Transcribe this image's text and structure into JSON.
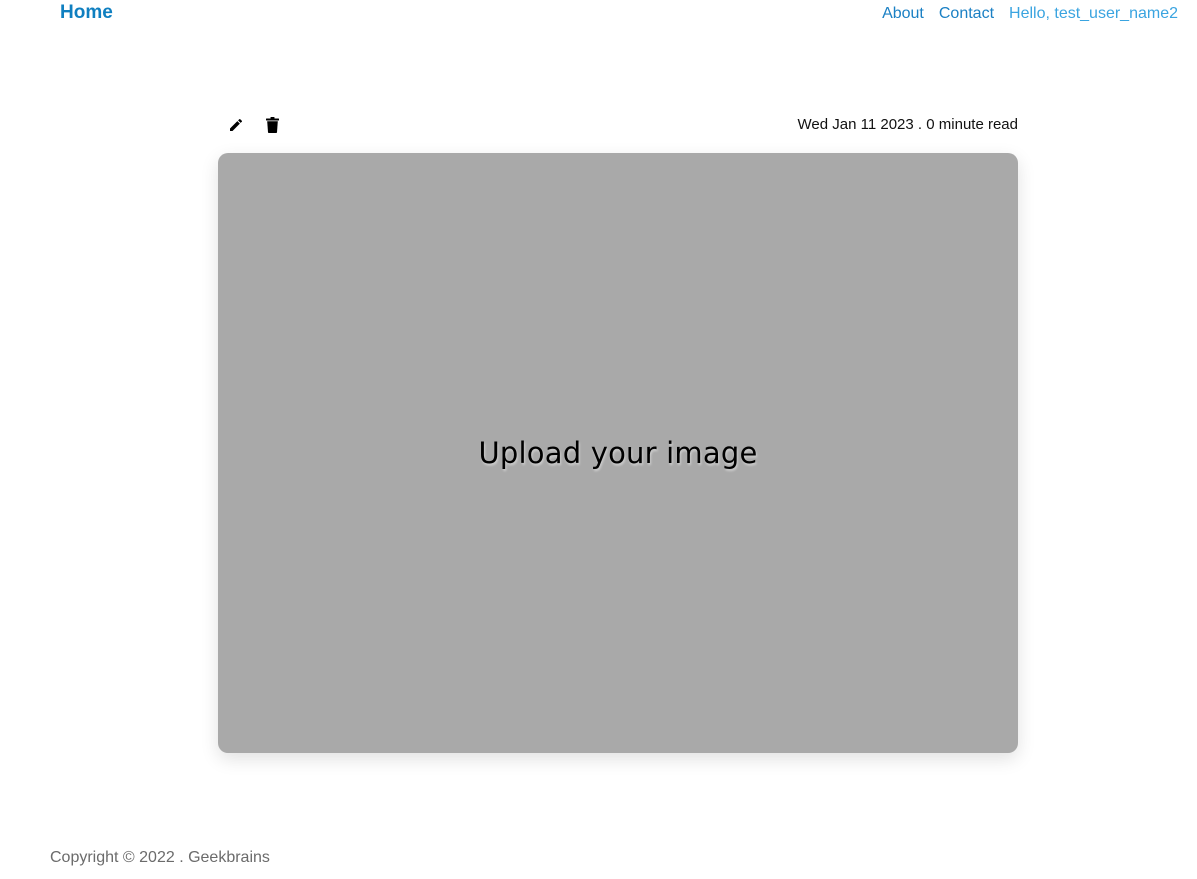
{
  "header": {
    "home_label": "Home",
    "nav": {
      "about": "About",
      "contact": "Contact",
      "greeting": "Hello, test_user_name2"
    }
  },
  "post": {
    "actions": {
      "edit_icon": "pencil-icon",
      "delete_icon": "trash-icon"
    },
    "meta": {
      "date": "Wed Jan 11 2023",
      "separator": " . ",
      "read_time": "0 minute read"
    },
    "image_placeholder": "Upload your image"
  },
  "footer": {
    "copyright": "Copyright © 2022 . Geekbrains"
  },
  "colors": {
    "link": "#1b80c4",
    "brand": "#0f7fc0",
    "greeting": "#3aa4e0",
    "placeholder_bg": "#a9a9a9"
  }
}
